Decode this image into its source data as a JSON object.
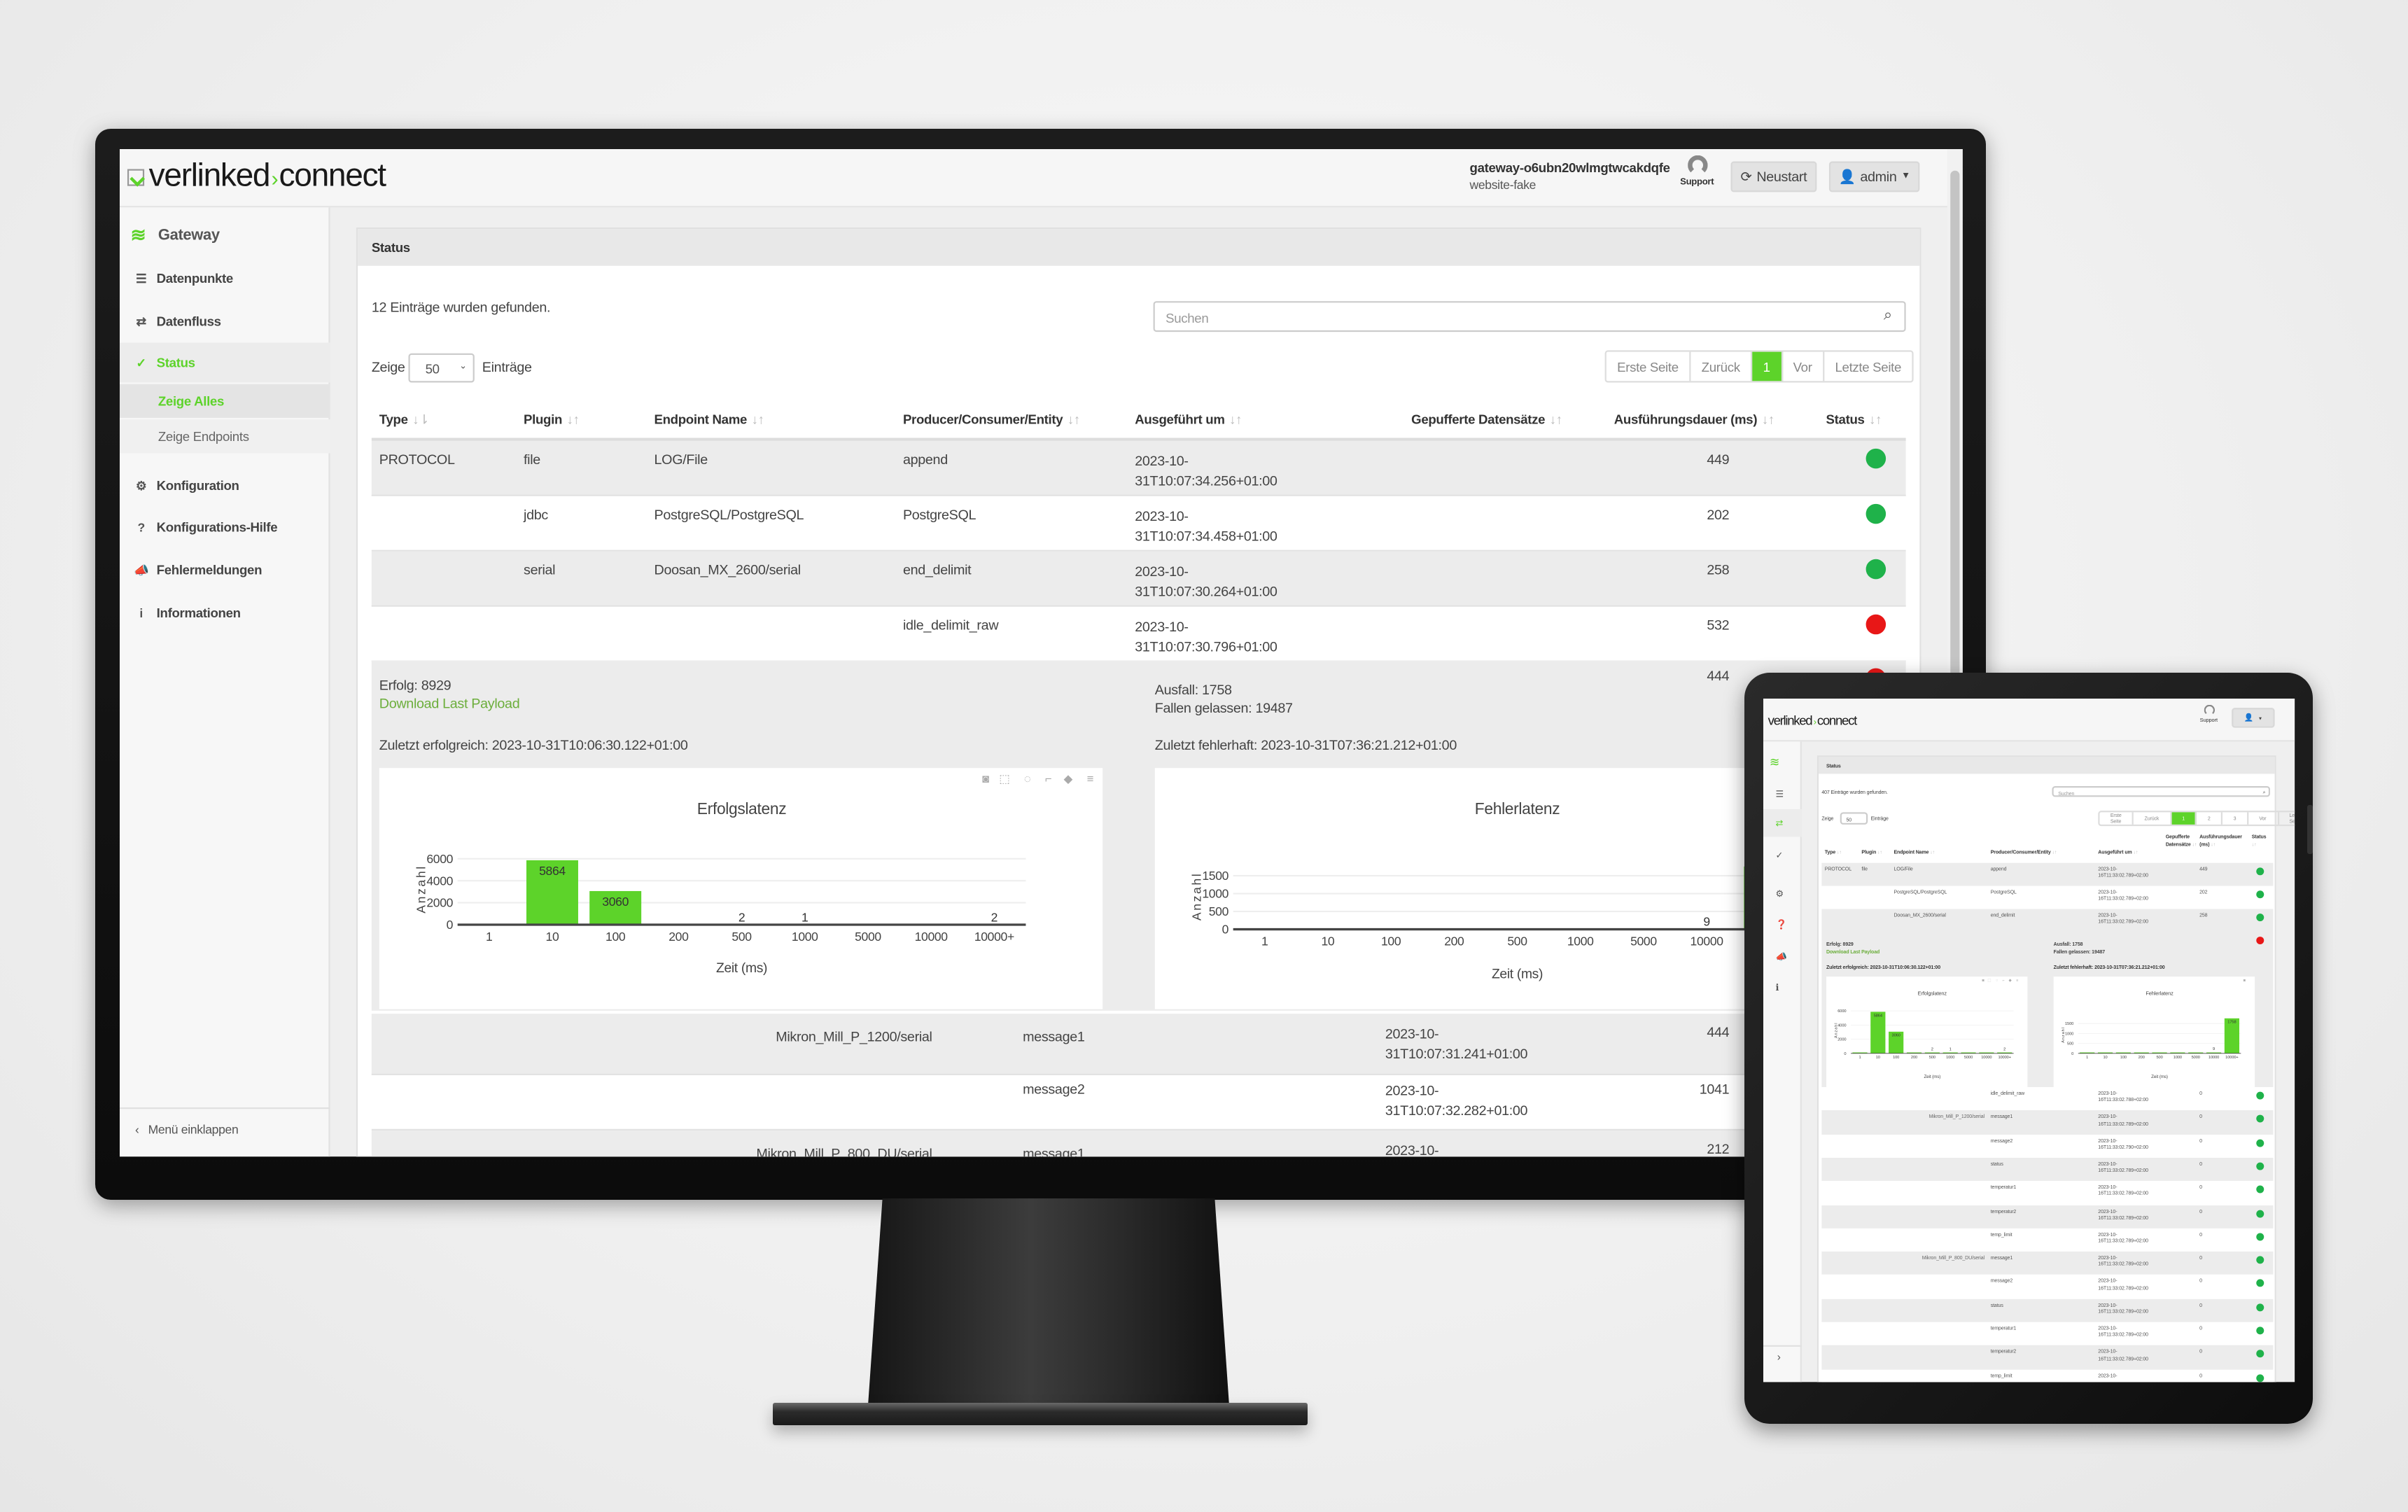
{
  "monitor": {
    "header": {
      "logo_left": "verlinked",
      "logo_separator": "›",
      "logo_right": "connect",
      "gateway_name": "gateway-o6ubn20wlmgtwcakdqfe",
      "gateway_subtitle": "website-fake",
      "support_label": "Support",
      "restart_label": "Neustart",
      "admin_label": "admin"
    },
    "sidebar": {
      "section_title": "Gateway",
      "items": [
        {
          "label": "Datenpunkte",
          "icon": "list-icon"
        },
        {
          "label": "Datenfluss",
          "icon": "exchange-icon"
        },
        {
          "label": "Status",
          "icon": "check-circle-icon",
          "active": true
        },
        {
          "label": "Konfiguration",
          "icon": "gear-icon"
        },
        {
          "label": "Konfigurations-Hilfe",
          "icon": "question-circle-icon"
        },
        {
          "label": "Fehlermeldungen",
          "icon": "megaphone-icon"
        },
        {
          "label": "Informationen",
          "icon": "info-circle-icon"
        }
      ],
      "sub_items": [
        {
          "label": "Zeige Alles",
          "active": true
        },
        {
          "label": "Zeige Endpoints"
        }
      ],
      "collapse_label": "Menü einklappen"
    },
    "panel": {
      "title": "Status",
      "count_text": "12 Einträge wurden gefunden.",
      "search_placeholder": "Suchen",
      "show_label": "Zeige",
      "show_value": "50",
      "entries_label": "Einträge",
      "pagination": [
        "Erste Seite",
        "Zurück",
        "1",
        "Vor",
        "Letzte Seite"
      ],
      "active_page": "1"
    },
    "table": {
      "columns": [
        "Type",
        "Plugin",
        "Endpoint Name",
        "Producer/Consumer/Entity",
        "Ausgeführt um",
        "Gepufferte Datensätze",
        "Ausführungsdauer (ms)",
        "Status"
      ],
      "rows": [
        {
          "type": "PROTOCOL",
          "plugin": "file",
          "endpoint": "LOG/File",
          "producer": "append",
          "executed": "2023-10-31T10:07:34.256+01:00",
          "duration": "449",
          "status": "ok"
        },
        {
          "type": "",
          "plugin": "jdbc",
          "endpoint": "PostgreSQL/PostgreSQL",
          "producer": "PostgreSQL",
          "executed": "2023-10-31T10:07:34.458+01:00",
          "duration": "202",
          "status": "ok"
        },
        {
          "type": "",
          "plugin": "serial",
          "endpoint": "Doosan_MX_2600/serial",
          "producer": "end_delimit",
          "executed": "2023-10-31T10:07:30.264+01:00",
          "duration": "258",
          "status": "ok"
        },
        {
          "type": "",
          "plugin": "",
          "endpoint": "",
          "producer": "idle_delimit_raw",
          "executed": "2023-10-31T10:07:30.796+01:00",
          "duration": "532",
          "status": "error"
        }
      ],
      "detail": {
        "duration": "444",
        "status": "error",
        "success_text": "Erfolg: 8929",
        "download_link": "Download Last Payload",
        "last_success": "Zuletzt erfolgreich: 2023-10-31T10:06:30.122+01:00",
        "failure_text": "Ausfall: 1758",
        "dropped_text": "Fallen gelassen: 19487",
        "last_failure": "Zuletzt fehlerhaft: 2023-10-31T07:36:21.212+01:00"
      },
      "lower_rows": [
        {
          "endpoint": "Mikron_Mill_P_1200/serial",
          "producer": "message1",
          "executed": "2023-10-31T10:07:31.241+01:00",
          "duration": "444"
        },
        {
          "endpoint": "",
          "producer": "message2",
          "executed": "2023-10-31T10:07:32.282+01:00",
          "duration": "1041"
        },
        {
          "endpoint": "Mikron_Mill_P_800_DU/serial",
          "producer": "message1",
          "executed": "2023-10-",
          "duration": "212"
        }
      ]
    }
  },
  "colors": {
    "accent": "#5dd32a",
    "ok": "#1fb24a",
    "error": "#e81717",
    "link": "#6cae3c"
  },
  "chart_data": [
    {
      "type": "bar",
      "title": "Erfolgslatenz",
      "xlabel": "Zeit (ms)",
      "ylabel": "Anzahl",
      "categories": [
        "1",
        "10",
        "100",
        "200",
        "500",
        "1000",
        "5000",
        "10000",
        "10000+"
      ],
      "values": [
        0,
        5864,
        3060,
        0,
        2,
        1,
        0,
        0,
        2
      ],
      "data_labels": [
        "",
        "5864",
        "3060",
        "",
        "2",
        "1",
        "",
        "",
        "2"
      ],
      "yticks": [
        0,
        2000,
        4000,
        6000
      ],
      "ylim": [
        0,
        6500
      ],
      "grid": true,
      "toolbar_icons": [
        "camera-icon",
        "box-select-icon",
        "lasso-icon",
        "spike-lines-icon",
        "hover-closest-icon",
        "hover-compare-icon"
      ]
    },
    {
      "type": "bar",
      "title": "Fehlerlatenz",
      "xlabel": "Zeit (ms)",
      "ylabel": "Anzahl",
      "categories": [
        "1",
        "10",
        "100",
        "200",
        "500",
        "1000",
        "5000",
        "10000",
        "10000+"
      ],
      "values": [
        0,
        0,
        0,
        0,
        0,
        0,
        0,
        9,
        1758
      ],
      "data_labels": [
        "",
        "",
        "",
        "",
        "",
        "",
        "",
        "9",
        "1758"
      ],
      "yticks": [
        0,
        500,
        1000,
        1500
      ],
      "ylim": [
        0,
        1850
      ],
      "grid": true,
      "toolbar_icons": [
        "camera-icon"
      ]
    }
  ],
  "tablet": {
    "support_label": "Support",
    "panel_title": "Status",
    "count_text": "407 Einträge wurden gefunden.",
    "search_placeholder": "Suchen",
    "show_label": "Zeige",
    "show_value": "50",
    "entries_label": "Einträge",
    "pagination": [
      "Erste Seite",
      "Zurück",
      "1",
      "2",
      "3",
      "Vor",
      "Letzte Seite"
    ],
    "active_page": "1",
    "columns": [
      "Type",
      "Plugin",
      "Endpoint Name",
      "Producer/Consumer/Entity",
      "Ausgeführt um",
      "Gepufferte Datensätze",
      "Ausführungsdauer (ms)",
      "Status"
    ],
    "top_rows": [
      {
        "type": "PROTOCOL",
        "plugin": "file",
        "endpoint": "LOG/File",
        "producer": "append",
        "executed": "2023-10-16T11:33:02.789+02:00",
        "duration": "449",
        "status": "ok"
      },
      {
        "type": "",
        "plugin": "",
        "endpoint": "PostgreSQL/PostgreSQL",
        "producer": "PostgreSQL",
        "executed": "2023-10-16T11:33:02.789+02:00",
        "duration": "202",
        "status": "ok"
      },
      {
        "type": "",
        "plugin": "",
        "endpoint": "Doosan_MX_2600/serial",
        "producer": "end_delimit",
        "executed": "2023-10-16T11:33:02.789+02:00",
        "duration": "258",
        "status": "ok"
      }
    ],
    "detail": {
      "status": "error",
      "success_text": "Erfolg: 8929",
      "download_link": "Download Last Payload",
      "last_success": "Zuletzt erfolgreich: 2023-10-31T10:06:30.122+01:00",
      "failure_text": "Ausfall: 1758",
      "dropped_text": "Fallen gelassen: 19487",
      "last_failure": "Zuletzt fehlerhaft: 2023-10-31T07:36:21.212+01:00"
    },
    "rows": [
      {
        "endpoint": "",
        "producer": "idle_delimit_raw",
        "executed": "2023-10-16T11:33:02.788+02:00",
        "duration": "0",
        "status": "ok"
      },
      {
        "endpoint": "Mikron_Mill_P_1200/serial",
        "producer": "message1",
        "executed": "2023-10-16T11:33:02.789+02:00",
        "duration": "0",
        "status": "ok"
      },
      {
        "endpoint": "",
        "producer": "message2",
        "executed": "2023-10-16T11:33:02.790+02:00",
        "duration": "0",
        "status": "ok"
      },
      {
        "endpoint": "",
        "producer": "status",
        "executed": "2023-10-16T11:33:02.789+02:00",
        "duration": "0",
        "status": "ok"
      },
      {
        "endpoint": "",
        "producer": "temperatur1",
        "executed": "2023-10-16T11:33:02.789+02:00",
        "duration": "0",
        "status": "ok"
      },
      {
        "endpoint": "",
        "producer": "temperatur2",
        "executed": "2023-10-16T11:33:02.789+02:00",
        "duration": "0",
        "status": "ok"
      },
      {
        "endpoint": "",
        "producer": "temp_limit",
        "executed": "2023-10-16T11:33:02.789+02:00",
        "duration": "0",
        "status": "ok"
      },
      {
        "endpoint": "Mikron_Mill_P_800_DU/serial",
        "producer": "message1",
        "executed": "2023-10-16T11:33:02.789+02:00",
        "duration": "0",
        "status": "ok"
      },
      {
        "endpoint": "",
        "producer": "message2",
        "executed": "2023-10-16T11:33:02.789+02:00",
        "duration": "0",
        "status": "ok"
      },
      {
        "endpoint": "",
        "producer": "status",
        "executed": "2023-10-16T11:33:02.789+02:00",
        "duration": "0",
        "status": "ok"
      },
      {
        "endpoint": "",
        "producer": "temperatur1",
        "executed": "2023-10-16T11:33:02.789+02:00",
        "duration": "0",
        "status": "ok"
      },
      {
        "endpoint": "",
        "producer": "temperatur2",
        "executed": "2023-10-16T11:33:02.789+02:00",
        "duration": "0",
        "status": "ok"
      },
      {
        "endpoint": "",
        "producer": "temp_limit",
        "executed": "2023-10-",
        "duration": "0",
        "status": "ok"
      }
    ]
  }
}
